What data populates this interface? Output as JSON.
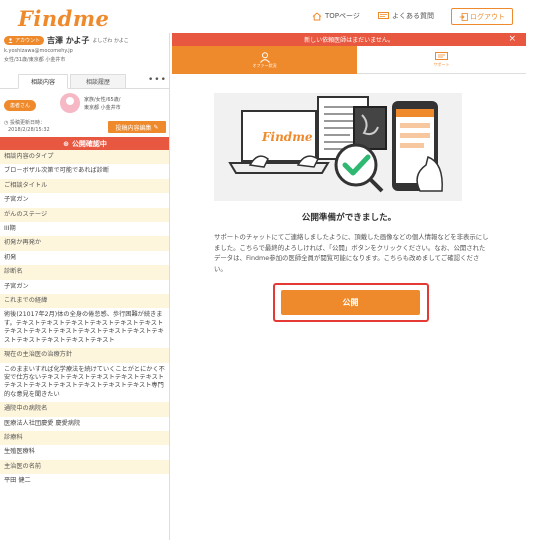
{
  "header": {
    "logo": "Findme",
    "nav_top": "TOPページ",
    "nav_faq": "よくある質問",
    "logout": "ログアウト"
  },
  "account": {
    "badge": "アカウント",
    "name": "吉澤 かよ子",
    "kana": "よしざわ かよこ",
    "email": "k.yoshizawa@mocomehy.jp",
    "attrs": "女性/31歳/東京都 小金井市"
  },
  "tabs": [
    "相談内容",
    "相談履歴"
  ],
  "more": "•••",
  "patient": {
    "badge": "患者さん",
    "info_line1": "家族/女性/65歳/",
    "info_line2": "東京都 小金井市",
    "post_date_label": "投稿更新日時：",
    "post_date": "2018/2/28/15:32",
    "edit_button": "投稿内容編集",
    "status": "公開確認中"
  },
  "info_rows": [
    {
      "text": "相談内容のタイプ",
      "head": true
    },
    {
      "text": "ブロ－ボザル次第で可能であれば診断",
      "head": false
    },
    {
      "text": "ご相談タイトル",
      "head": true
    },
    {
      "text": "子宮ガン",
      "head": false
    },
    {
      "text": "がんのステージ",
      "head": true
    },
    {
      "text": "III期",
      "head": false
    },
    {
      "text": "初発か再発か",
      "head": true
    },
    {
      "text": "初発",
      "head": false
    },
    {
      "text": "診断名",
      "head": true
    },
    {
      "text": "子宮ガン",
      "head": false
    },
    {
      "text": "これまでの経緯",
      "head": true
    },
    {
      "text": "術後(21017年2月)体の全身の倦怠感、歩行困難が続きます。テキストテキストテキストテキストテキストテキストテキストテキストテキストテキストテキストテキストテキストテキストテキストテキストテキスト",
      "head": false
    },
    {
      "text": "現在の主治医の治療方針",
      "head": true
    },
    {
      "text": "このままいすれば化学療法を続けていくことがとにかく不安で仕方ないテキストテキストテキストテキストテキストテキストテキストテキストテキストテキストテキスト専門的な意見を聞きたい",
      "head": false
    },
    {
      "text": "通院中の病院名",
      "head": true
    },
    {
      "text": "医療法人社団慶愛 慶愛病院",
      "head": false
    },
    {
      "text": "診療科",
      "head": true
    },
    {
      "text": "生殖医療科",
      "head": false
    },
    {
      "text": "主治医の名前",
      "head": true
    },
    {
      "text": "平田 健二",
      "head": false
    }
  ],
  "alert": "新しい依頼医師はまだいません。",
  "steps": [
    "オファー状況",
    "サポート"
  ],
  "illustration_logo": "Findme",
  "ready_heading": "公開準備ができました。",
  "ready_body": "サポートのチャットにてご連絡しましたように、頂戴した画像などの個人情報などを非表示にしました。こちらで最終的よろしければ、「公開」ボタンをクリックください。なお、公開されたデータは、Findme参加の医師全員が閲覧可能になります。こちらも改めましてご確認ください。",
  "publish_button": "公開",
  "colors": {
    "accent": "#ef8a2c",
    "alert": "#e8573f",
    "highlight_frame": "#e53935",
    "row_head_bg": "#fdf5dc"
  }
}
